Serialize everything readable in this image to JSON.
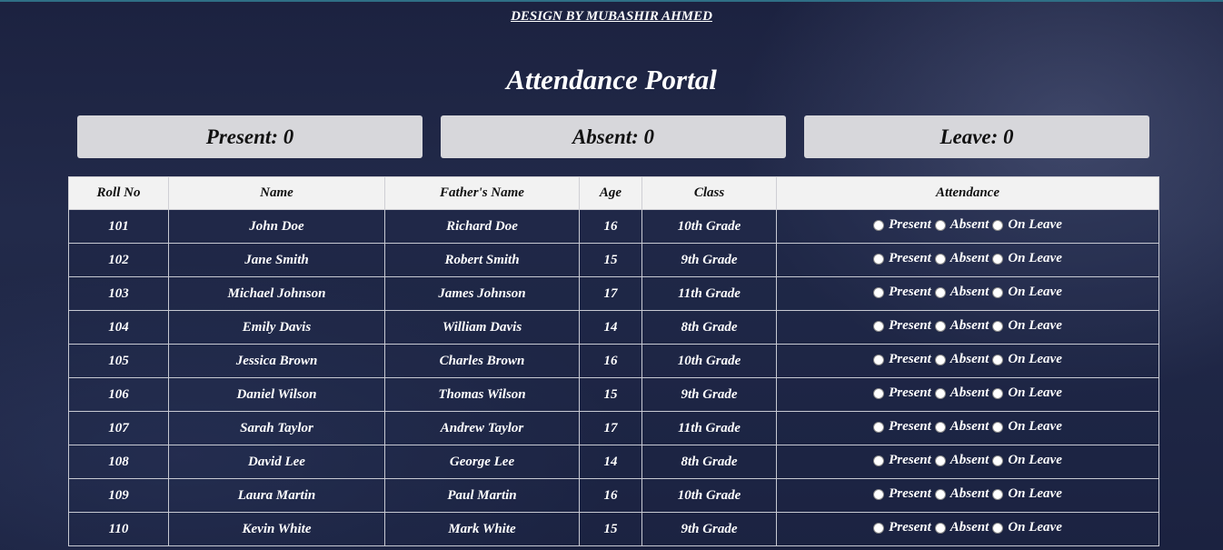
{
  "header": {
    "credit": "DESIGN BY MUBASHIR AHMED",
    "title": "Attendance Portal"
  },
  "summary": {
    "present": "Present: 0",
    "absent": "Absent: 0",
    "leave": "Leave: 0"
  },
  "table": {
    "columns": [
      "Roll No",
      "Name",
      "Father's Name",
      "Age",
      "Class",
      "Attendance"
    ],
    "options": [
      "Present",
      "Absent",
      "On Leave"
    ],
    "rows": [
      [
        "101",
        "John Doe",
        "Richard Doe",
        "16",
        "10th Grade"
      ],
      [
        "102",
        "Jane Smith",
        "Robert Smith",
        "15",
        "9th Grade"
      ],
      [
        "103",
        "Michael Johnson",
        "James Johnson",
        "17",
        "11th Grade"
      ],
      [
        "104",
        "Emily Davis",
        "William Davis",
        "14",
        "8th Grade"
      ],
      [
        "105",
        "Jessica Brown",
        "Charles Brown",
        "16",
        "10th Grade"
      ],
      [
        "106",
        "Daniel Wilson",
        "Thomas Wilson",
        "15",
        "9th Grade"
      ],
      [
        "107",
        "Sarah Taylor",
        "Andrew Taylor",
        "17",
        "11th Grade"
      ],
      [
        "108",
        "David Lee",
        "George Lee",
        "14",
        "8th Grade"
      ],
      [
        "109",
        "Laura Martin",
        "Paul Martin",
        "16",
        "10th Grade"
      ],
      [
        "110",
        "Kevin White",
        "Mark White",
        "15",
        "9th Grade"
      ]
    ]
  }
}
